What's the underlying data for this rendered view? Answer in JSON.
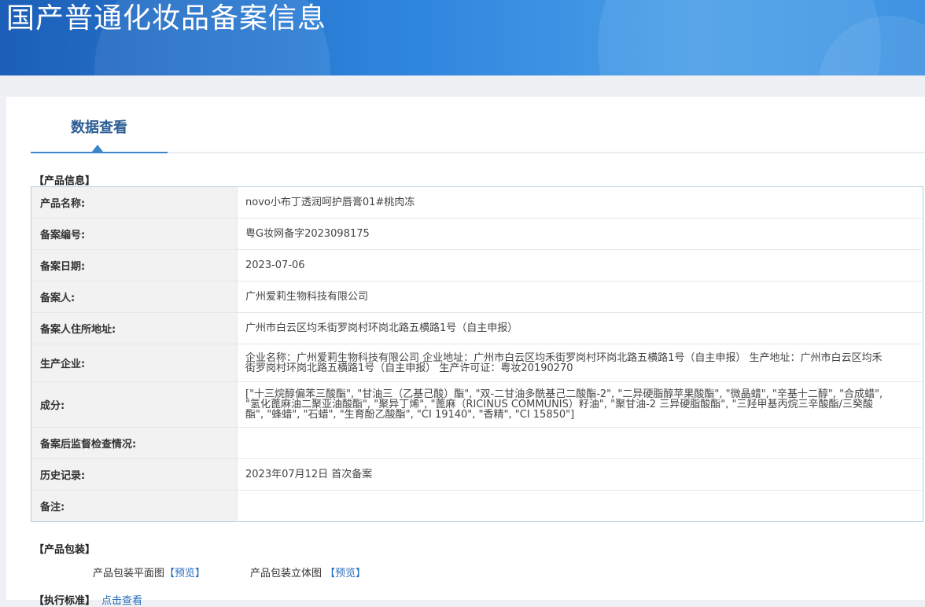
{
  "header": {
    "title": "国产普通化妆品备案信息"
  },
  "tabs": [
    {
      "label": "数据查看"
    }
  ],
  "product_info": {
    "section_label": "【产品信息】",
    "rows": [
      {
        "key": "产品名称:",
        "value": "novo小布丁透润呵护唇膏01#桃肉冻"
      },
      {
        "key": "备案编号:",
        "value": "粤G妆网备字2023098175"
      },
      {
        "key": "备案日期:",
        "value": "2023-07-06"
      },
      {
        "key": "备案人:",
        "value": "广州爱莉生物科技有限公司"
      },
      {
        "key": "备案人住所地址:",
        "value": "广州市白云区均禾街罗岗村环岗北路五横路1号（自主申报）"
      },
      {
        "key": "生产企业:",
        "value": "企业名称：广州爱莉生物科技有限公司 企业地址：广州市白云区均禾街罗岗村环岗北路五横路1号（自主申报） 生产地址：广州市白云区均禾街罗岗村环岗北路五横路1号（自主申报） 生产许可证：粤妆20190270"
      },
      {
        "key": "成分:",
        "value": "[\"十三烷醇偏苯三酸酯\", \"甘油三（乙基己酸）酯\", \"双-二甘油多酰基己二酸酯-2\", \"二异硬脂醇苹果酸酯\", \"微晶蜡\", \"辛基十二醇\", \"合成蜡\", \"氢化蓖麻油二聚亚油酸酯\", \"聚异丁烯\", \"蓖麻（RICINUS COMMUNIS）籽油\", \"聚甘油-2 三异硬脂酸酯\", \"三羟甲基丙烷三辛酸酯/三癸酸酯\", \"蜂蜡\", \"石蜡\", \"生育酚乙酸酯\", \"CI 19140\", \"香精\", \"CI 15850\"]"
      },
      {
        "key": "备案后监督检查情况:",
        "value": ""
      },
      {
        "key": "历史记录:",
        "value": "2023年07月12日 首次备案"
      },
      {
        "key": "备注:",
        "value": ""
      }
    ]
  },
  "packaging": {
    "section_label": "【产品包装】",
    "flat_label": "产品包装平面图",
    "flat_link": "【预览】",
    "solid_label": "产品包装立体图",
    "solid_link": "【预览】"
  },
  "standard": {
    "label": "【执行标准】",
    "link": "点击查看"
  }
}
